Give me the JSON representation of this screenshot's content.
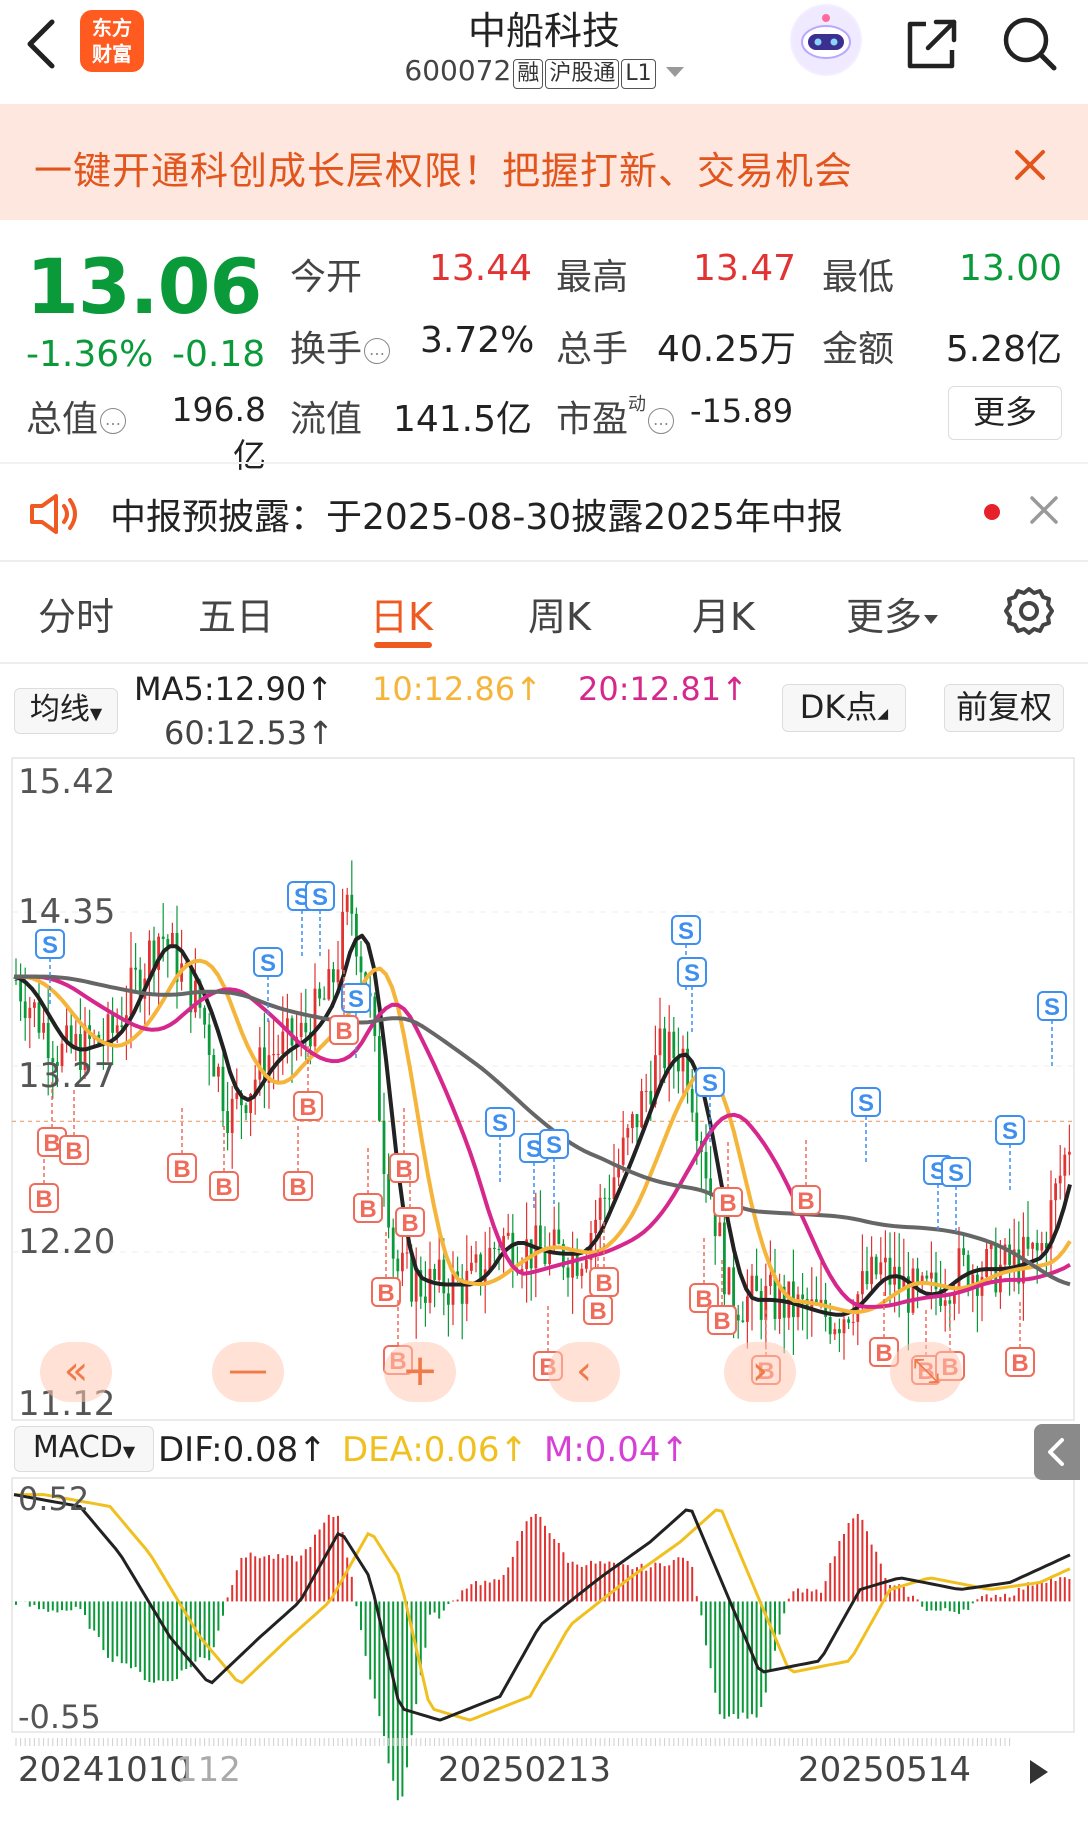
{
  "header": {
    "title": "中船科技",
    "code": "600072",
    "tags": [
      "融",
      "沪股通",
      "L1"
    ],
    "logo_text_top": "东方",
    "logo_text_bottom": "财富"
  },
  "banner": {
    "text": "一键开通科创成长层权限！把握打新、交易机会"
  },
  "quote": {
    "price": "13.06",
    "change_pct": "-1.36%",
    "change": "-0.18",
    "open_label": "今开",
    "open": "13.44",
    "high_label": "最高",
    "high": "13.47",
    "low_label": "最低",
    "low": "13.00",
    "turnover_label": "换手",
    "turnover": "3.72%",
    "volume_label": "总手",
    "volume": "40.25万",
    "amount_label": "金额",
    "amount": "5.28亿",
    "mcap_label": "总值",
    "mcap": "196.8亿",
    "float_label": "流值",
    "float": "141.5亿",
    "pe_label": "市盈",
    "pe_super": "动",
    "pe": "-15.89",
    "more": "更多"
  },
  "notice": {
    "text": "中报预披露：于2025-08-30披露2025年中报"
  },
  "tabs": {
    "items": [
      "分时",
      "五日",
      "日K",
      "周K",
      "月K",
      "更多"
    ],
    "active_index": 2
  },
  "ma_row": {
    "indicator_select": "均线",
    "ma5": "MA5:12.90↑",
    "ma10": "10:12.86↑",
    "ma20": "20:12.81↑",
    "ma60": "60:12.53↑",
    "dk_button": "DK点",
    "adjust_button": "前复权"
  },
  "colors": {
    "up": "#e23333",
    "down": "#0a9a3a",
    "ma5": "#222222",
    "ma10": "#f5b53a",
    "ma20": "#d6288c",
    "ma60": "#666666",
    "accent": "#ef5a22"
  },
  "kline": {
    "y_labels": [
      "15.42",
      "14.35",
      "13.27",
      "12.20",
      "11.12"
    ],
    "y_range": [
      11.12,
      15.42
    ],
    "reference_price": 13.06
  },
  "macd": {
    "select": "MACD",
    "dif": "DIF:0.08↑",
    "dea": "DEA:0.06↑",
    "m": "M:0.04↑",
    "y_labels": [
      "0.52",
      "-0.55"
    ],
    "y_range": [
      -0.55,
      0.52
    ]
  },
  "x_axis": {
    "labels": [
      "20241010",
      "112",
      "20250213",
      "20250514"
    ]
  },
  "icons": {
    "back": "chevron-left-icon",
    "share": "share-icon",
    "search": "search-icon",
    "close": "close-icon",
    "speaker": "speaker-icon",
    "settings": "gear-icon",
    "play": "play-icon",
    "collapse": "chevron-left-icon",
    "rewind": "double-chevron-left-icon",
    "zoom_out": "minus-icon",
    "zoom_in": "plus-icon",
    "prev": "chevron-left-icon",
    "next": "chevron-right-icon",
    "shrink": "arrows-in-icon"
  },
  "signals": {
    "sell": "S",
    "buy": "B"
  }
}
